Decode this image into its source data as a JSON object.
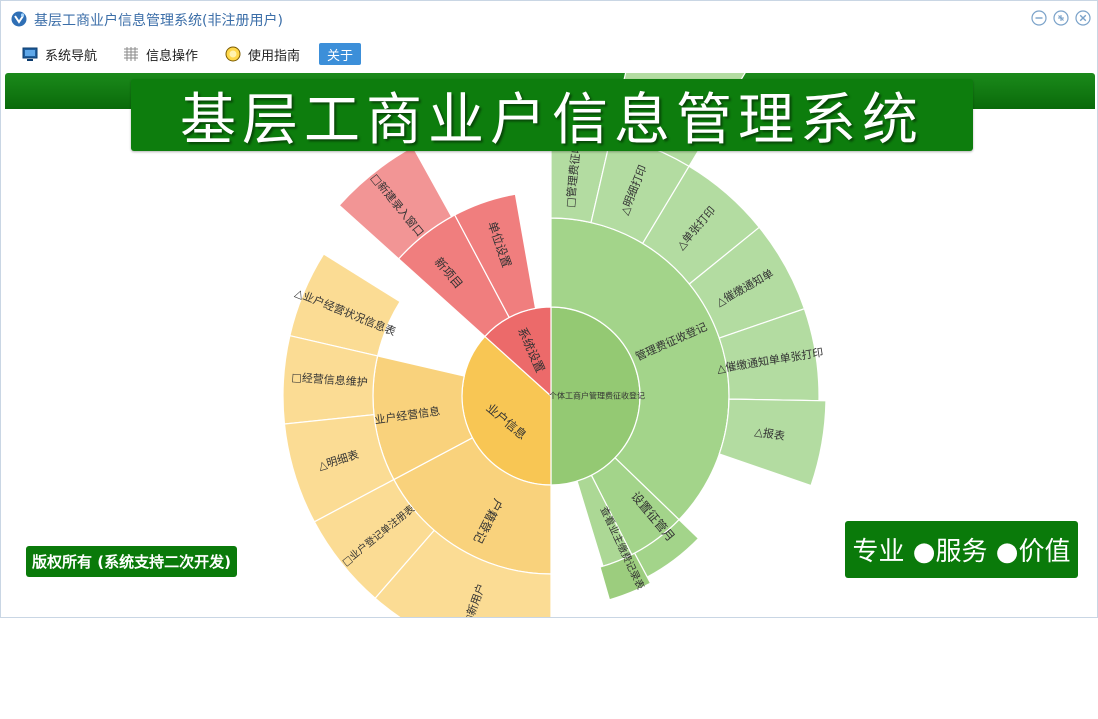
{
  "window": {
    "title": "基层工商业户信息管理系统(非注册用户)"
  },
  "menu": {
    "items": [
      {
        "label": "系统导航",
        "icon": "monitor-icon"
      },
      {
        "label": "信息操作",
        "icon": "grid-icon"
      },
      {
        "label": "使用指南",
        "icon": "lightbulb-icon"
      },
      {
        "label": "关于",
        "icon": ""
      }
    ]
  },
  "banner": {
    "title": "基层工商业户信息管理系统"
  },
  "footer": {
    "copyright": "版权所有 (系统支持二次开发)",
    "slogan": "专业 ●服务 ●价值"
  },
  "colors": {
    "brand_green": "#0a7a0a",
    "accent_blue": "#3c8fd9",
    "title_blue": "#3b6ea8"
  },
  "chart_data": {
    "type": "sunburst",
    "rings": [
      {
        "name": "个体工商户管理费征收登记",
        "color": "#94c973",
        "children": [
          {
            "name": "管理费征收登记",
            "color": "#a3d48a",
            "children": [
              {
                "name": "□管理费征收",
                "marker": ""
              },
              {
                "name": "明细打印",
                "marker": "△"
              },
              {
                "name": "单张打印",
                "marker": "△"
              },
              {
                "name": "催缴通知单",
                "marker": "△"
              },
              {
                "name": "催缴通知单单张打印",
                "marker": "△"
              },
              {
                "name": "报表",
                "marker": "△"
              }
            ]
          },
          {
            "name": "设置征管月",
            "color": "#a3d48a",
            "children": []
          },
          {
            "name": "查看业主缴费记录表",
            "color": "#a3d48a",
            "children": []
          }
        ]
      },
      {
        "name": "业户信息",
        "color": "#f8c654",
        "children": [
          {
            "name": "业户经营信息",
            "color": "#f9d27c",
            "children": [
              {
                "name": "业户经营状况信息表",
                "marker": "△"
              },
              {
                "name": "经营信息维护",
                "marker": "□"
              }
            ]
          },
          {
            "name": "户籍登记",
            "color": "#f9d27c",
            "children": [
              {
                "name": "明细表",
                "marker": "△"
              },
              {
                "name": "业户登记单注册表",
                "marker": "□"
              },
              {
                "name": "新用户",
                "marker": "□"
              }
            ]
          }
        ]
      },
      {
        "name": "系统设置",
        "color": "#ec6a6a",
        "children": [
          {
            "name": "新项目",
            "color": "#f07e7e",
            "children": [
              {
                "name": "新建录入窗口",
                "marker": "□"
              }
            ]
          },
          {
            "name": "单位设置",
            "color": "#f07e7e",
            "children": []
          }
        ]
      }
    ]
  }
}
